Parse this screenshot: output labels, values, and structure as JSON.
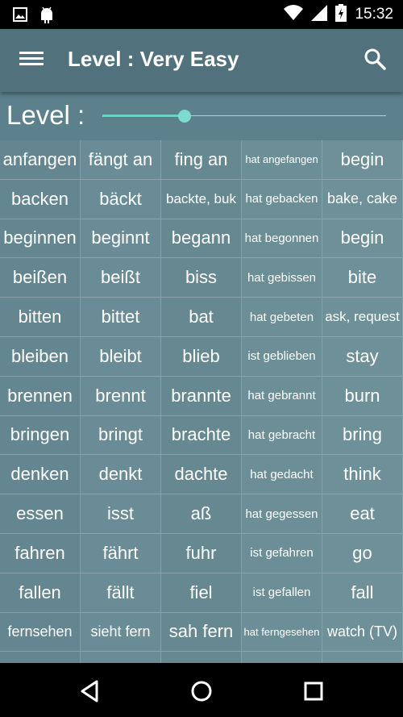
{
  "status_bar": {
    "time": "15:32"
  },
  "app_bar": {
    "title": "Level : Very Easy"
  },
  "level": {
    "label": "Level :",
    "slider_value": 0.29
  },
  "verbs": [
    {
      "infinitive": "anfangen",
      "present": "fängt an",
      "past": "fing an",
      "perfect": "hat angefangen",
      "english": "begin"
    },
    {
      "infinitive": "backen",
      "present": "bäckt",
      "past": "backte, buk",
      "perfect": "hat gebacken",
      "english": "bake, cake"
    },
    {
      "infinitive": "beginnen",
      "present": "beginnt",
      "past": "begann",
      "perfect": "hat begonnen",
      "english": "begin"
    },
    {
      "infinitive": "beißen",
      "present": "beißt",
      "past": "biss",
      "perfect": "hat gebissen",
      "english": "bite"
    },
    {
      "infinitive": "bitten",
      "present": "bittet",
      "past": "bat",
      "perfect": "hat gebeten",
      "english": "ask, request"
    },
    {
      "infinitive": "bleiben",
      "present": "bleibt",
      "past": "blieb",
      "perfect": "ist geblieben",
      "english": "stay"
    },
    {
      "infinitive": "brennen",
      "present": "brennt",
      "past": "brannte",
      "perfect": "hat gebrannt",
      "english": "burn"
    },
    {
      "infinitive": "bringen",
      "present": "bringt",
      "past": "brachte",
      "perfect": "hat gebracht",
      "english": "bring"
    },
    {
      "infinitive": "denken",
      "present": "denkt",
      "past": "dachte",
      "perfect": "hat gedacht",
      "english": "think"
    },
    {
      "infinitive": "essen",
      "present": "isst",
      "past": "aß",
      "perfect": "hat gegessen",
      "english": "eat"
    },
    {
      "infinitive": "fahren",
      "present": "fährt",
      "past": "fuhr",
      "perfect": "ist gefahren",
      "english": "go"
    },
    {
      "infinitive": "fallen",
      "present": "fällt",
      "past": "fiel",
      "perfect": "ist gefallen",
      "english": "fall"
    },
    {
      "infinitive": "fernsehen",
      "present": "sieht fern",
      "past": "sah fern",
      "perfect": "hat ferngesehen",
      "english": "watch (TV)"
    }
  ],
  "colors": {
    "app_bar": "#51727d",
    "accent": "#7ddccd",
    "grid": "#648690"
  },
  "icons": [
    "image-icon",
    "android-icon",
    "wifi-icon",
    "signal-icon",
    "battery-icon",
    "menu-icon",
    "search-icon",
    "back-icon",
    "home-icon",
    "recents-icon"
  ]
}
